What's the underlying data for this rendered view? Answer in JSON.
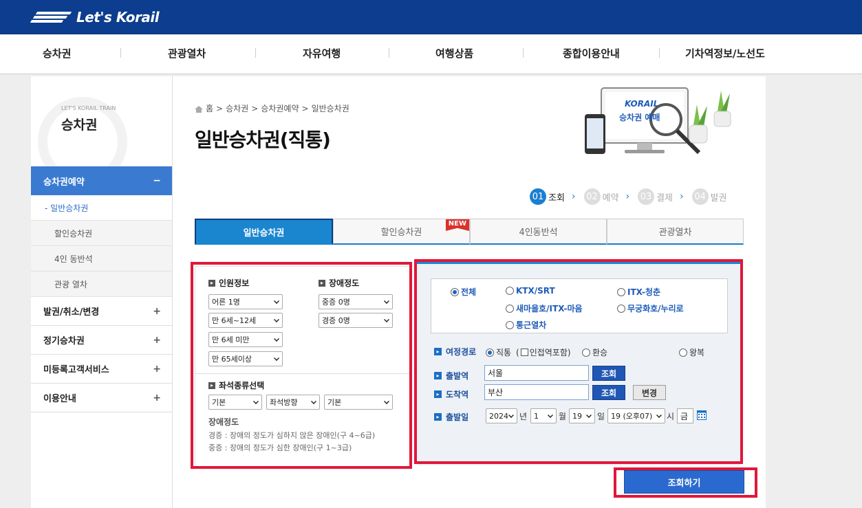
{
  "header": {
    "logo_text": "Let's Korail"
  },
  "gnb": [
    "승차권",
    "관광열차",
    "자유여행",
    "여행상품",
    "종합이용안내",
    "기차역정보/노선도"
  ],
  "sidebar": {
    "small_caption": "LET'S KORAIL TRAIN",
    "title": "승차권",
    "active": {
      "label": "승차권예약",
      "toggle": "−"
    },
    "subs": [
      "- 일반승차권",
      "할인승차권",
      "4인 동반석",
      "관광 열차"
    ],
    "menus": [
      {
        "label": "발권/취소/변경",
        "toggle": "+"
      },
      {
        "label": "정기승차권",
        "toggle": "+"
      },
      {
        "label": "미등록고객서비스",
        "toggle": "+"
      },
      {
        "label": "이용안내",
        "toggle": "+"
      }
    ]
  },
  "breadcrumb": [
    "홈",
    ">",
    "승차권",
    ">",
    "승차권예약",
    ">",
    "일반승차권"
  ],
  "page_title": "일반승차권(직통)",
  "illustration": {
    "brand": "KORAIL",
    "text": "승차권 예매"
  },
  "steps": [
    {
      "num": "01",
      "label": "조회",
      "active": true
    },
    {
      "num": "02",
      "label": "예약",
      "active": false
    },
    {
      "num": "03",
      "label": "결제",
      "active": false
    },
    {
      "num": "04",
      "label": "발권",
      "active": false
    }
  ],
  "tabs": [
    {
      "label": "일반승차권",
      "active": true
    },
    {
      "label": "할인승차권",
      "badge": "NEW"
    },
    {
      "label": "4인동반석"
    },
    {
      "label": "관광열차"
    }
  ],
  "passengers": {
    "label": "인원정보",
    "selects": [
      "어른 1명",
      "만 6세~12세",
      "만 6세 미만",
      "만 65세이상"
    ]
  },
  "disability": {
    "label": "장애정도",
    "selects": [
      "중증 0명",
      "경증 0명"
    ]
  },
  "seat": {
    "label": "좌석종류선택",
    "selects": [
      "기본",
      "좌석방향",
      "기본"
    ]
  },
  "disability_note": {
    "title": "장애정도",
    "line1": "경증 : 장애의 정도가 심하지 않은 장애인(구 4~6급)",
    "line2": "중증 : 장애의 정도가 심한 장애인(구 1~3급)"
  },
  "train_types": [
    {
      "label": "전체",
      "checked": true
    },
    {
      "label": "KTX/SRT"
    },
    {
      "label": "ITX-청춘"
    },
    {
      "label": "새마을호/ITX-마음"
    },
    {
      "label": "무궁화호/누리로"
    },
    {
      "label": "통근열차"
    }
  ],
  "route": {
    "label": "여정경로",
    "direct": "직통",
    "paren_open": "(",
    "transfer_station": "인접역포함)",
    "transfer": "환승",
    "roundtrip": "왕복"
  },
  "departure": {
    "label": "출발역",
    "value": "서울",
    "button": "조회"
  },
  "arrival": {
    "label": "도착역",
    "value": "부산",
    "button": "조회",
    "swap": "변경"
  },
  "date": {
    "label": "출발일",
    "year": "2024",
    "year_unit": "년",
    "month": "1",
    "month_unit": "월",
    "day": "19",
    "day_unit": "일",
    "hour": "19 (오후07)",
    "hour_unit": "시",
    "weekday": "금"
  },
  "search_button": "조회하기",
  "colors": {
    "header": "#0c3d8e",
    "accent": "#1a86cf",
    "highlight": "#e0173a"
  }
}
